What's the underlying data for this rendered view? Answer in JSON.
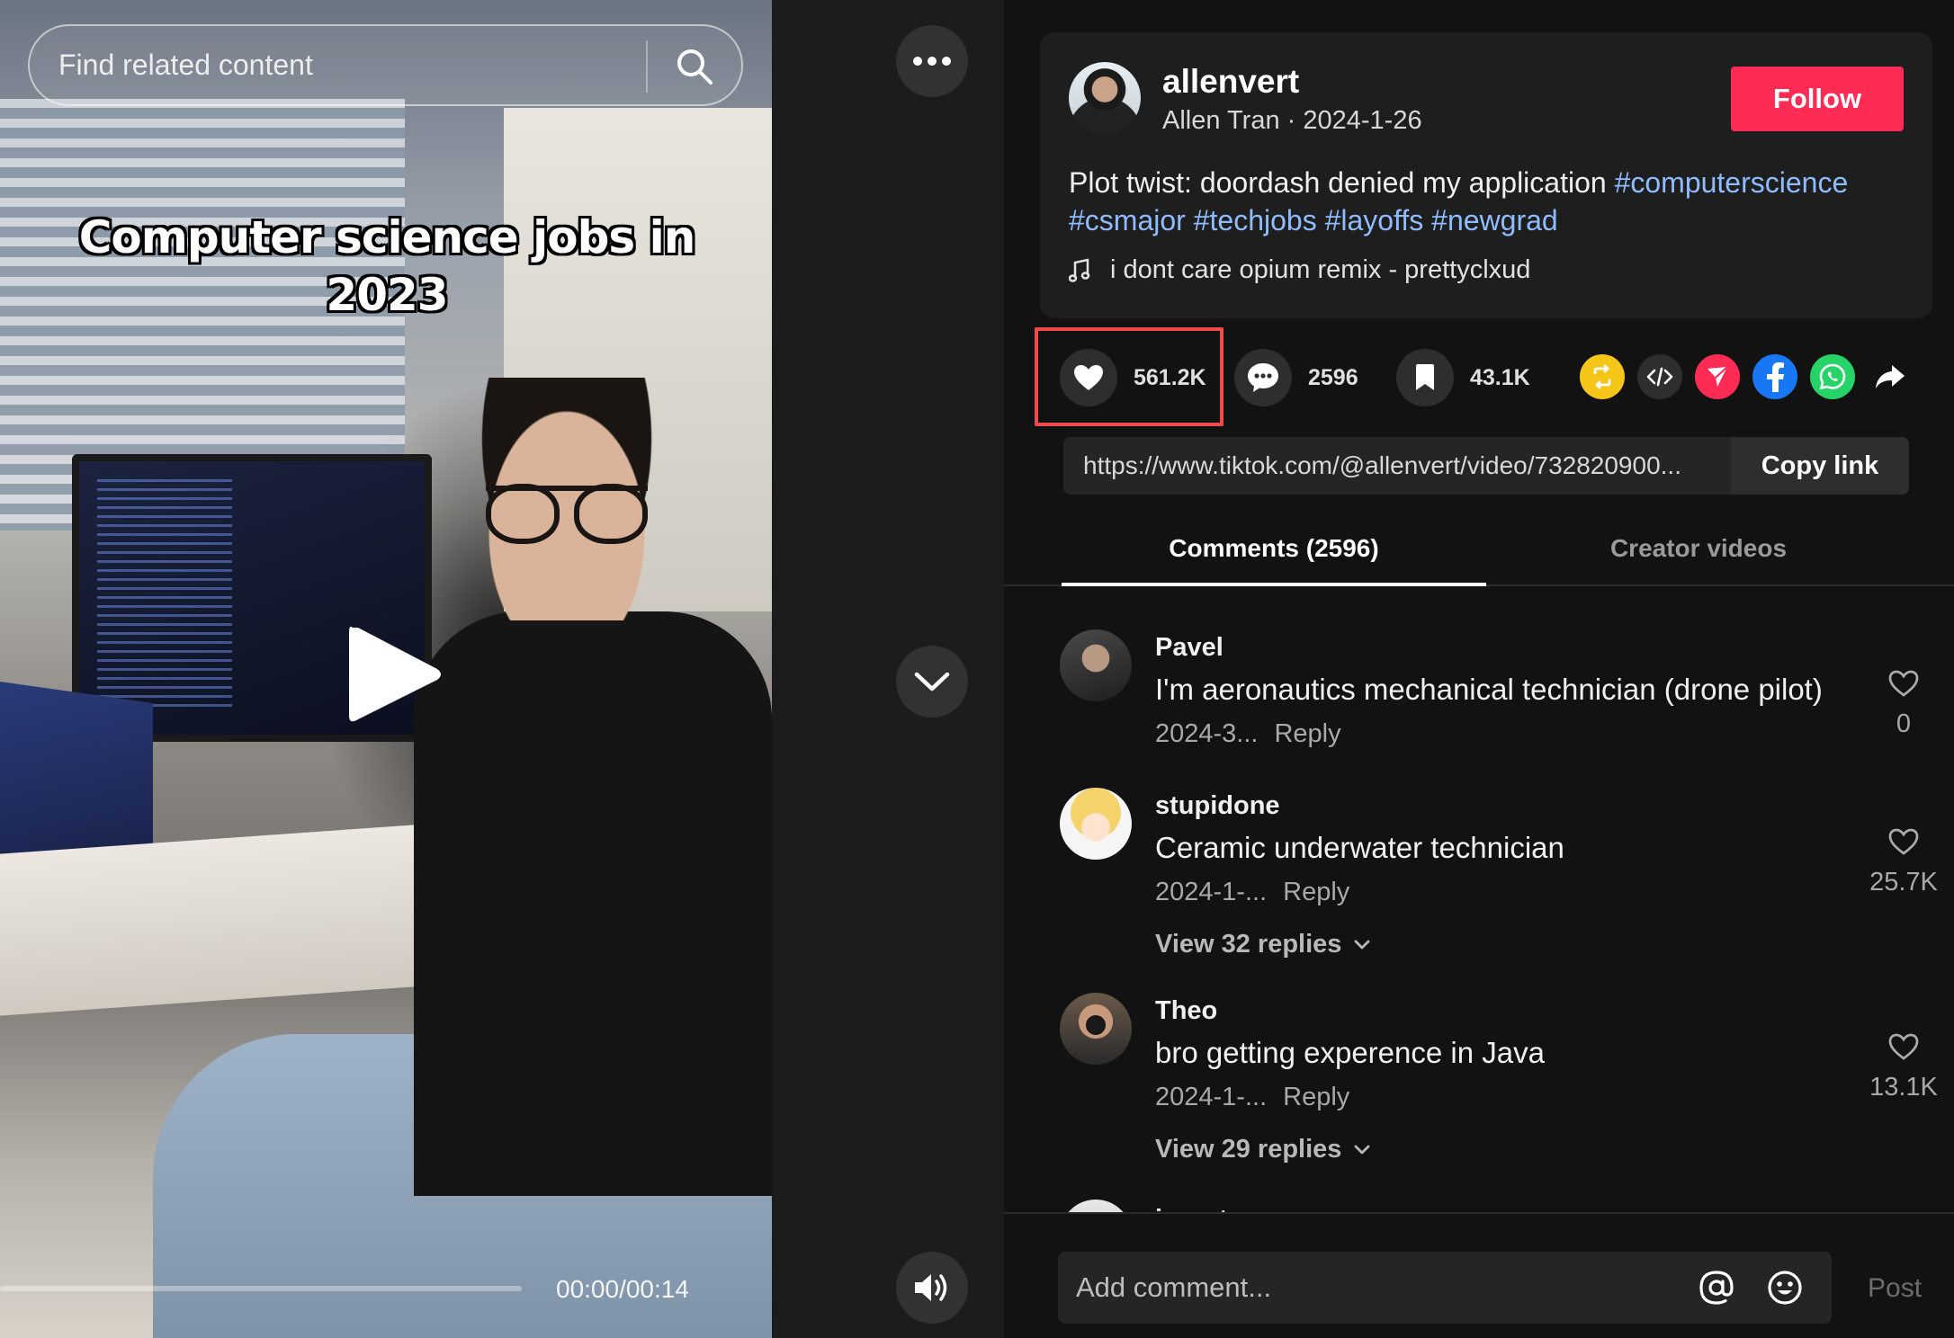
{
  "video": {
    "search_placeholder": "Find related content",
    "overlay_title": "Computer science jobs in 2023",
    "time": "00:00/00:14",
    "progress": 0
  },
  "post": {
    "username": "allenvert",
    "display_name": "Allen Tran",
    "date": "2024-1-26",
    "follow_label": "Follow",
    "caption_text": "Plot twist: doordash denied my application",
    "hashtags": [
      "#computerscience",
      "#csmajor",
      "#techjobs",
      "#layoffs",
      "#newgrad"
    ],
    "music": "i dont care opium remix - prettyclxud"
  },
  "actions": {
    "likes": "561.2K",
    "comments": "2596",
    "saves": "43.1K"
  },
  "share": {
    "link": "https://www.tiktok.com/@allenvert/video/732820900...",
    "copy_label": "Copy link",
    "icons": [
      "repost-icon",
      "embed-icon",
      "send-icon",
      "facebook-icon",
      "whatsapp-icon",
      "share-arrow-icon"
    ]
  },
  "tabs": {
    "comments": "Comments (2596)",
    "creator": "Creator videos"
  },
  "comments": [
    {
      "name": "Pavel",
      "text": "I'm aeronautics mechanical technician (drone pilot)",
      "date": "2024-3...",
      "reply": "Reply",
      "likes": "0",
      "replies": ""
    },
    {
      "name": "stupidone",
      "text": "Ceramic underwater technician",
      "date": "2024-1-...",
      "reply": "Reply",
      "likes": "25.7K",
      "replies": "View 32 replies"
    },
    {
      "name": "Theo",
      "text": "bro getting experence in Java",
      "date": "2024-1-...",
      "reply": "Reply",
      "likes": "13.1K",
      "replies": "View 29 replies"
    },
    {
      "name": "jeront",
      "text": "",
      "date": "",
      "reply": "",
      "likes": "",
      "replies": ""
    }
  ],
  "composer": {
    "placeholder": "Add comment...",
    "post_label": "Post"
  },
  "colors": {
    "accent": "#fe2c55",
    "hashtag": "#8fbcff",
    "highlight": "#f04b4b"
  }
}
